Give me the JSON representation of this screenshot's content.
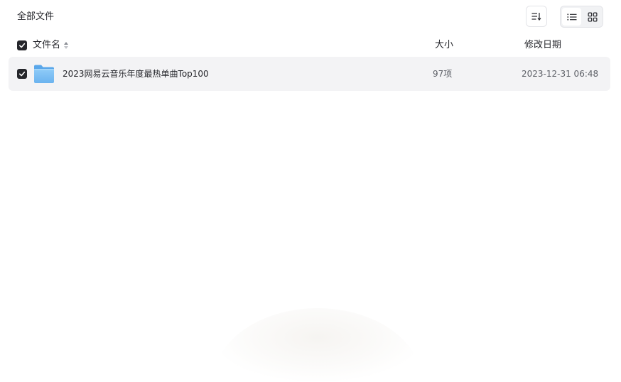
{
  "header": {
    "title": "全部文件",
    "sort_button_icon": "sort-lines-arrow-down-icon",
    "view_modes": [
      {
        "name": "list",
        "icon": "list-icon",
        "active": true
      },
      {
        "name": "grid",
        "icon": "grid-icon",
        "active": false
      }
    ]
  },
  "table": {
    "select_all_checked": true,
    "columns": [
      {
        "key": "name",
        "label": "文件名",
        "sortable": true,
        "sort_icon": "sort-updown-icon"
      },
      {
        "key": "size",
        "label": "大小"
      },
      {
        "key": "modified",
        "label": "修改日期"
      }
    ],
    "rows": [
      {
        "selected": true,
        "type": "folder",
        "icon": "folder-icon",
        "name": "2023网易云音乐年度最热单曲Top100",
        "size": "97项",
        "modified": "2023-12-31 06:48"
      }
    ]
  },
  "colors": {
    "text_primary": "#25262b",
    "text_secondary": "#5c5f66",
    "row_selected_bg": "#f3f3f5",
    "checkbox_fill": "#25262b",
    "folder_blue": "#7cc0f5",
    "border": "#e3e4e8"
  }
}
